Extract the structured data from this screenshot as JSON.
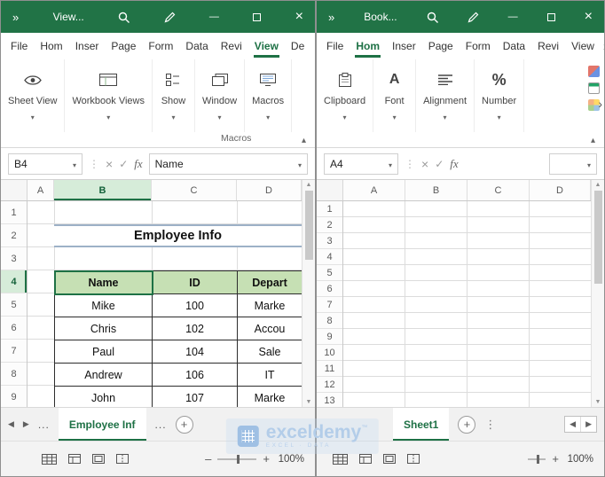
{
  "watermark": {
    "brand": "exceldemy",
    "tm": "™",
    "tagline": "EXCEL · DATA"
  },
  "left": {
    "titlebar": {
      "title": "View..."
    },
    "tabs": [
      "File",
      "Hom",
      "Inser",
      "Page",
      "Form",
      "Data",
      "Revi",
      "View",
      "De"
    ],
    "ribbon_groups": [
      "Sheet View",
      "Workbook Views",
      "Show",
      "Window",
      "Macros"
    ],
    "ribbon_footer": "Macros",
    "name_box": "B4",
    "fx": "fx",
    "formula_value": "Name",
    "cols": [
      "A",
      "B",
      "C",
      "D"
    ],
    "rows": [
      "1",
      "2",
      "3",
      "4",
      "5",
      "6",
      "7",
      "8",
      "9"
    ],
    "sheet_title": "Employee Info",
    "table": {
      "headers": [
        "Name",
        "ID",
        "Depart"
      ],
      "rows": [
        [
          "Mike",
          "100",
          "Marke"
        ],
        [
          "Chris",
          "102",
          "Accou"
        ],
        [
          "Paul",
          "104",
          "Sale"
        ],
        [
          "Andrew",
          "106",
          "IT"
        ],
        [
          "John",
          "107",
          "Marke"
        ]
      ]
    },
    "sheet_tabs": {
      "hidden_left": "...",
      "active": "Employee Inf",
      "hidden_right": "..."
    },
    "zoom": "100%"
  },
  "right": {
    "titlebar": {
      "title": "Book..."
    },
    "tabs": [
      "File",
      "Hom",
      "Inser",
      "Page",
      "Form",
      "Data",
      "Revi",
      "View"
    ],
    "ribbon_groups": [
      "Clipboard",
      "Font",
      "Alignment",
      "Number"
    ],
    "name_box": "A4",
    "fx": "fx",
    "formula_value": "",
    "cols": [
      "A",
      "B",
      "C",
      "D"
    ],
    "rows": [
      "1",
      "2",
      "3",
      "4",
      "5",
      "6",
      "7",
      "8",
      "9",
      "10",
      "11",
      "12",
      "13"
    ],
    "sheet_tabs": {
      "active": "Sheet1"
    },
    "zoom": "100%"
  }
}
